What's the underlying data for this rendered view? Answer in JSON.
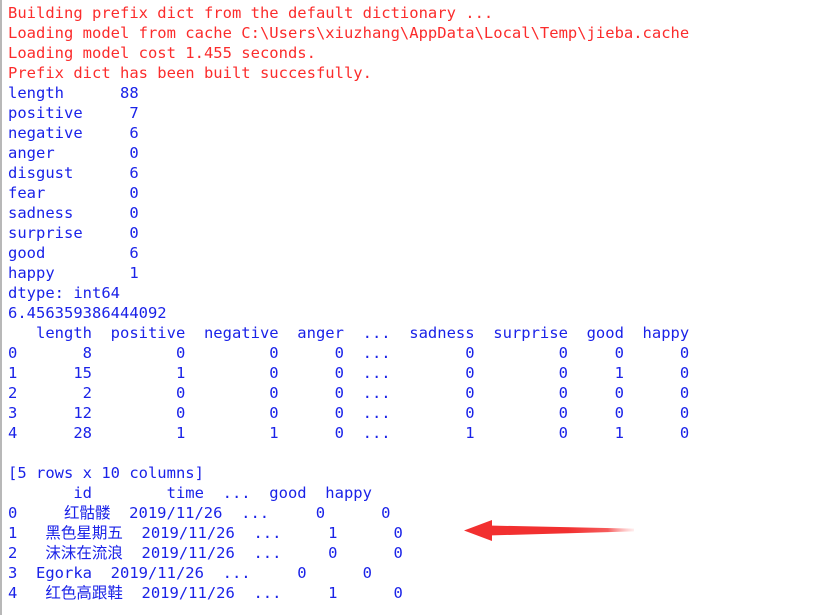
{
  "window": {
    "kind": "python-console-output",
    "background_color": "#ffffff",
    "stderr_color": "#fb2c2c",
    "stdout_color": "#1a22e8",
    "annotation_color": "#f23030"
  },
  "console": {
    "stderr_lines": [
      "Building prefix dict from the default dictionary ...",
      "Loading model from cache C:\\Users\\xiuzhang\\AppData\\Local\\Temp\\jieba.cache",
      "Loading model cost 1.455 seconds.",
      "Prefix dict has been built succesfully."
    ],
    "series_output": {
      "rows": [
        {
          "name": "length",
          "value": "88"
        },
        {
          "name": "positive",
          "value": "7"
        },
        {
          "name": "negative",
          "value": "6"
        },
        {
          "name": "anger",
          "value": "0"
        },
        {
          "name": "disgust",
          "value": "6"
        },
        {
          "name": "fear",
          "value": "0"
        },
        {
          "name": "sadness",
          "value": "0"
        },
        {
          "name": "surprise",
          "value": "0"
        },
        {
          "name": "good",
          "value": "6"
        },
        {
          "name": "happy",
          "value": "1"
        }
      ],
      "dtype_line": "dtype: int64"
    },
    "scalar_output": "6.456359386444092",
    "dataframe_numeric": {
      "header_line": "   length  positive  negative  anger  ...  sadness  surprise  good  happy",
      "columns": [
        "length",
        "positive",
        "negative",
        "anger",
        "...",
        "sadness",
        "surprise",
        "good",
        "happy"
      ],
      "rows": [
        {
          "index": "0",
          "cells": [
            "8",
            "0",
            "0",
            "0",
            "...",
            "0",
            "0",
            "0",
            "0"
          ]
        },
        {
          "index": "1",
          "cells": [
            "15",
            "1",
            "0",
            "0",
            "...",
            "0",
            "0",
            "1",
            "0"
          ]
        },
        {
          "index": "2",
          "cells": [
            "2",
            "0",
            "0",
            "0",
            "...",
            "0",
            "0",
            "0",
            "0"
          ]
        },
        {
          "index": "3",
          "cells": [
            "12",
            "0",
            "0",
            "0",
            "...",
            "0",
            "0",
            "0",
            "0"
          ]
        },
        {
          "index": "4",
          "cells": [
            "28",
            "1",
            "1",
            "0",
            "...",
            "1",
            "0",
            "1",
            "0"
          ]
        }
      ],
      "row_lines": [
        "0       8         0         0      0  ...        0         0     0      0",
        "1      15         1         0      0  ...        0         0     1      0",
        "2       2         0         0      0  ...        0         0     0      0",
        "3      12         0         0      0  ...        0         0     0      0",
        "4      28         1         1      0  ...        1         0     1      0"
      ],
      "shape_line": "[5 rows x 10 columns]"
    },
    "dataframe_text": {
      "header_line": "       id        time  ...  good  happy",
      "columns": [
        "id",
        "time",
        "...",
        "good",
        "happy"
      ],
      "rows": [
        {
          "index": "0",
          "id": "红骷髅",
          "time": "2019/11/26",
          "ellipsis": "...",
          "good": "0",
          "happy": "0"
        },
        {
          "index": "1",
          "id": "黑色星期五",
          "time": "2019/11/26",
          "ellipsis": "...",
          "good": "1",
          "happy": "0"
        },
        {
          "index": "2",
          "id": "沫沫在流浪",
          "time": "2019/11/26",
          "ellipsis": "...",
          "good": "0",
          "happy": "0"
        },
        {
          "index": "3",
          "id": "Egorka",
          "time": "2019/11/26",
          "ellipsis": "...",
          "good": "0",
          "happy": "0"
        },
        {
          "index": "4",
          "id": "红色高跟鞋",
          "time": "2019/11/26",
          "ellipsis": "...",
          "good": "1",
          "happy": "0"
        }
      ],
      "row_lines": [
        "0     红骷髅  2019/11/26  ...     0      0",
        "1   黑色星期五  2019/11/26  ...     1      0",
        "2   沫沫在流浪  2019/11/26  ...     0      0",
        "3  Egorka  2019/11/26  ...     0      0",
        "4   红色高跟鞋  2019/11/26  ...     1      0"
      ]
    },
    "lines": [
      {
        "id": "l0",
        "style": "err",
        "text": "Building prefix dict from the default dictionary ..."
      },
      {
        "id": "l1",
        "style": "err",
        "text": "Loading model from cache C:\\Users\\xiuzhang\\AppData\\Local\\Temp\\jieba.cache"
      },
      {
        "id": "l2",
        "style": "err",
        "text": "Loading model cost 1.455 seconds."
      },
      {
        "id": "l3",
        "style": "err",
        "text": "Prefix dict has been built succesfully."
      },
      {
        "id": "l4",
        "style": "out",
        "text": "length      88"
      },
      {
        "id": "l5",
        "style": "out",
        "text": "positive     7"
      },
      {
        "id": "l6",
        "style": "out",
        "text": "negative     6"
      },
      {
        "id": "l7",
        "style": "out",
        "text": "anger        0"
      },
      {
        "id": "l8",
        "style": "out",
        "text": "disgust      6"
      },
      {
        "id": "l9",
        "style": "out",
        "text": "fear         0"
      },
      {
        "id": "l10",
        "style": "out",
        "text": "sadness      0"
      },
      {
        "id": "l11",
        "style": "out",
        "text": "surprise     0"
      },
      {
        "id": "l12",
        "style": "out",
        "text": "good         6"
      },
      {
        "id": "l13",
        "style": "out",
        "text": "happy        1"
      },
      {
        "id": "l14",
        "style": "out",
        "text": "dtype: int64"
      },
      {
        "id": "l15",
        "style": "out",
        "text": "6.456359386444092"
      },
      {
        "id": "l16",
        "style": "out",
        "text": "   length  positive  negative  anger  ...  sadness  surprise  good  happy"
      },
      {
        "id": "l17",
        "style": "out",
        "text": "0       8         0         0      0  ...        0         0     0      0"
      },
      {
        "id": "l18",
        "style": "out",
        "text": "1      15         1         0      0  ...        0         0     1      0"
      },
      {
        "id": "l19",
        "style": "out",
        "text": "2       2         0         0      0  ...        0         0     0      0"
      },
      {
        "id": "l20",
        "style": "out",
        "text": "3      12         0         0      0  ...        0         0     0      0"
      },
      {
        "id": "l21",
        "style": "out",
        "text": "4      28         1         1      0  ...        1         0     1      0"
      },
      {
        "id": "l22",
        "style": "blank",
        "text": ""
      },
      {
        "id": "l23",
        "style": "out",
        "text": "[5 rows x 10 columns]"
      },
      {
        "id": "l24",
        "style": "out",
        "text": "       id        time  ...  good  happy"
      },
      {
        "id": "l25",
        "style": "out",
        "text": "0     红骷髅  2019/11/26  ...     0      0"
      },
      {
        "id": "l26",
        "style": "out",
        "text": "1   黑色星期五  2019/11/26  ...     1      0"
      },
      {
        "id": "l27",
        "style": "out",
        "text": "2   沫沫在流浪  2019/11/26  ...     0      0"
      },
      {
        "id": "l28",
        "style": "out",
        "text": "3  Egorka  2019/11/26  ...     0      0"
      },
      {
        "id": "l29",
        "style": "out",
        "text": "4   红色高跟鞋  2019/11/26  ...     1      0"
      }
    ]
  },
  "annotation": {
    "type": "arrow",
    "direction": "left",
    "color": "#f23030",
    "points_at_line": "l26"
  }
}
